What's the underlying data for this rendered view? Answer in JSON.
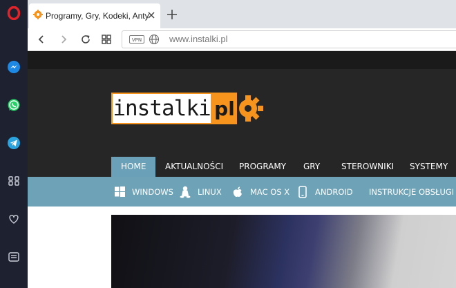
{
  "browser": {
    "tab": {
      "title": "Programy, Gry, Kodeki, Antywirusy"
    },
    "address_bar": {
      "vpn_label": "VPN",
      "url": "www.instalki.pl"
    }
  },
  "site": {
    "logo_text": "instalki",
    "logo_suffix": "pl",
    "main_nav": [
      {
        "label": "HOME",
        "active": true
      },
      {
        "label": "AKTUALNOŚCI"
      },
      {
        "label": "PROGRAMY"
      },
      {
        "label": "GRY"
      },
      {
        "label": "STEROWNIKI"
      },
      {
        "label": "SYSTEMY"
      }
    ],
    "sub_nav": [
      {
        "label": "WINDOWS",
        "icon": "windows-icon"
      },
      {
        "label": "LINUX",
        "icon": "linux-icon"
      },
      {
        "label": "MAC OS X",
        "icon": "apple-icon"
      },
      {
        "label": "ANDROID",
        "icon": "phone-icon"
      },
      {
        "label": "INSTRUKCJE OBSŁUGI"
      }
    ]
  },
  "colors": {
    "sidebar": "#1e2230",
    "opera_red": "#e1242a",
    "logo_orange": "#f7941e",
    "nav_blue": "#6ea3b7",
    "header_dark": "#262626"
  }
}
